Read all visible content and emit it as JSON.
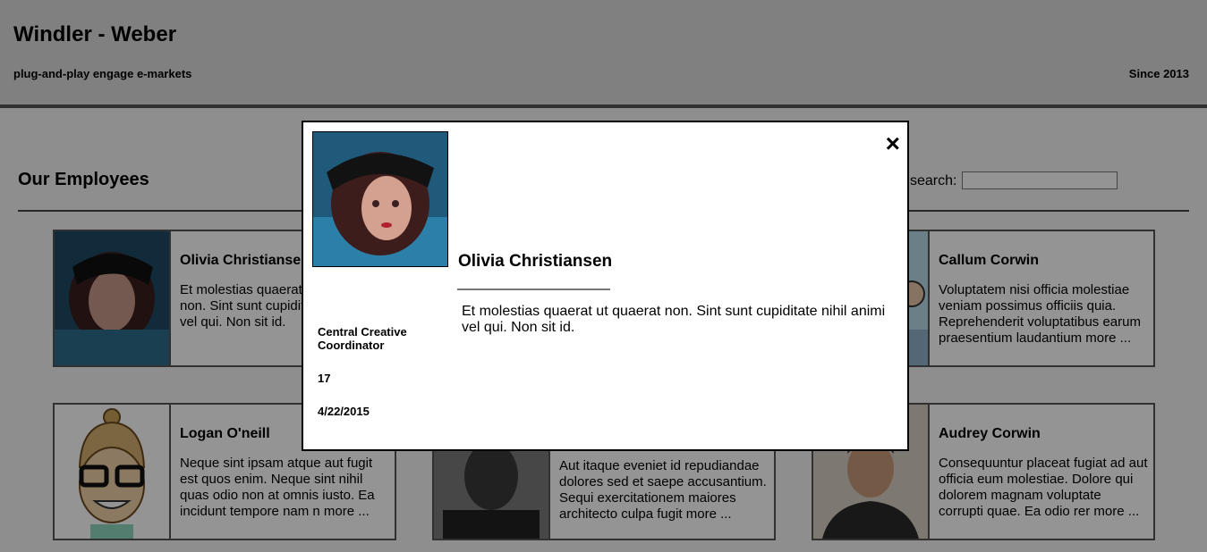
{
  "header": {
    "company": "Windler - Weber",
    "tagline": "plug-and-play engage e-markets",
    "since": "Since 2013"
  },
  "employees_section": {
    "title": "Our Employees",
    "search_label": "search:",
    "search_value": ""
  },
  "cards": [
    {
      "name": "Olivia Christiansen",
      "bio": "Et molestias quaerat ut quaerat non. Sint sunt cupiditate nihil animi vel qui. Non sit id."
    },
    {
      "name": "Callum Corwin",
      "bio": "Voluptatem nisi officia molestiae veniam possimus officiis quia. Reprehenderit voluptatibus earum praesentium laudantium more ..."
    },
    {
      "name": "Logan O'neill",
      "bio": "Neque sint ipsam atque aut fugit est quos enim. Neque sint nihil quas odio non at omnis iusto. Ea incidunt tempore nam n more ..."
    },
    {
      "name": "",
      "bio": "Aut itaque eveniet id repudiandae dolores sed et saepe accusantium. Sequi exercitationem maiores architecto culpa fugit more ..."
    },
    {
      "name": "Audrey Corwin",
      "bio": "Consequuntur placeat fugiat ad aut officia eum molestiae. Dolore qui dolorem magnam voluptate corrupti quae. Ea odio rer more ..."
    }
  ],
  "modal": {
    "close_icon": "×",
    "name": "Olivia Christiansen",
    "bio": "Et molestias quaerat ut quaerat non. Sint sunt cupiditate nihil animi vel qui. Non sit id.",
    "title": "Central Creative Coordinator",
    "age": "17",
    "start_date": "4/22/2015"
  }
}
